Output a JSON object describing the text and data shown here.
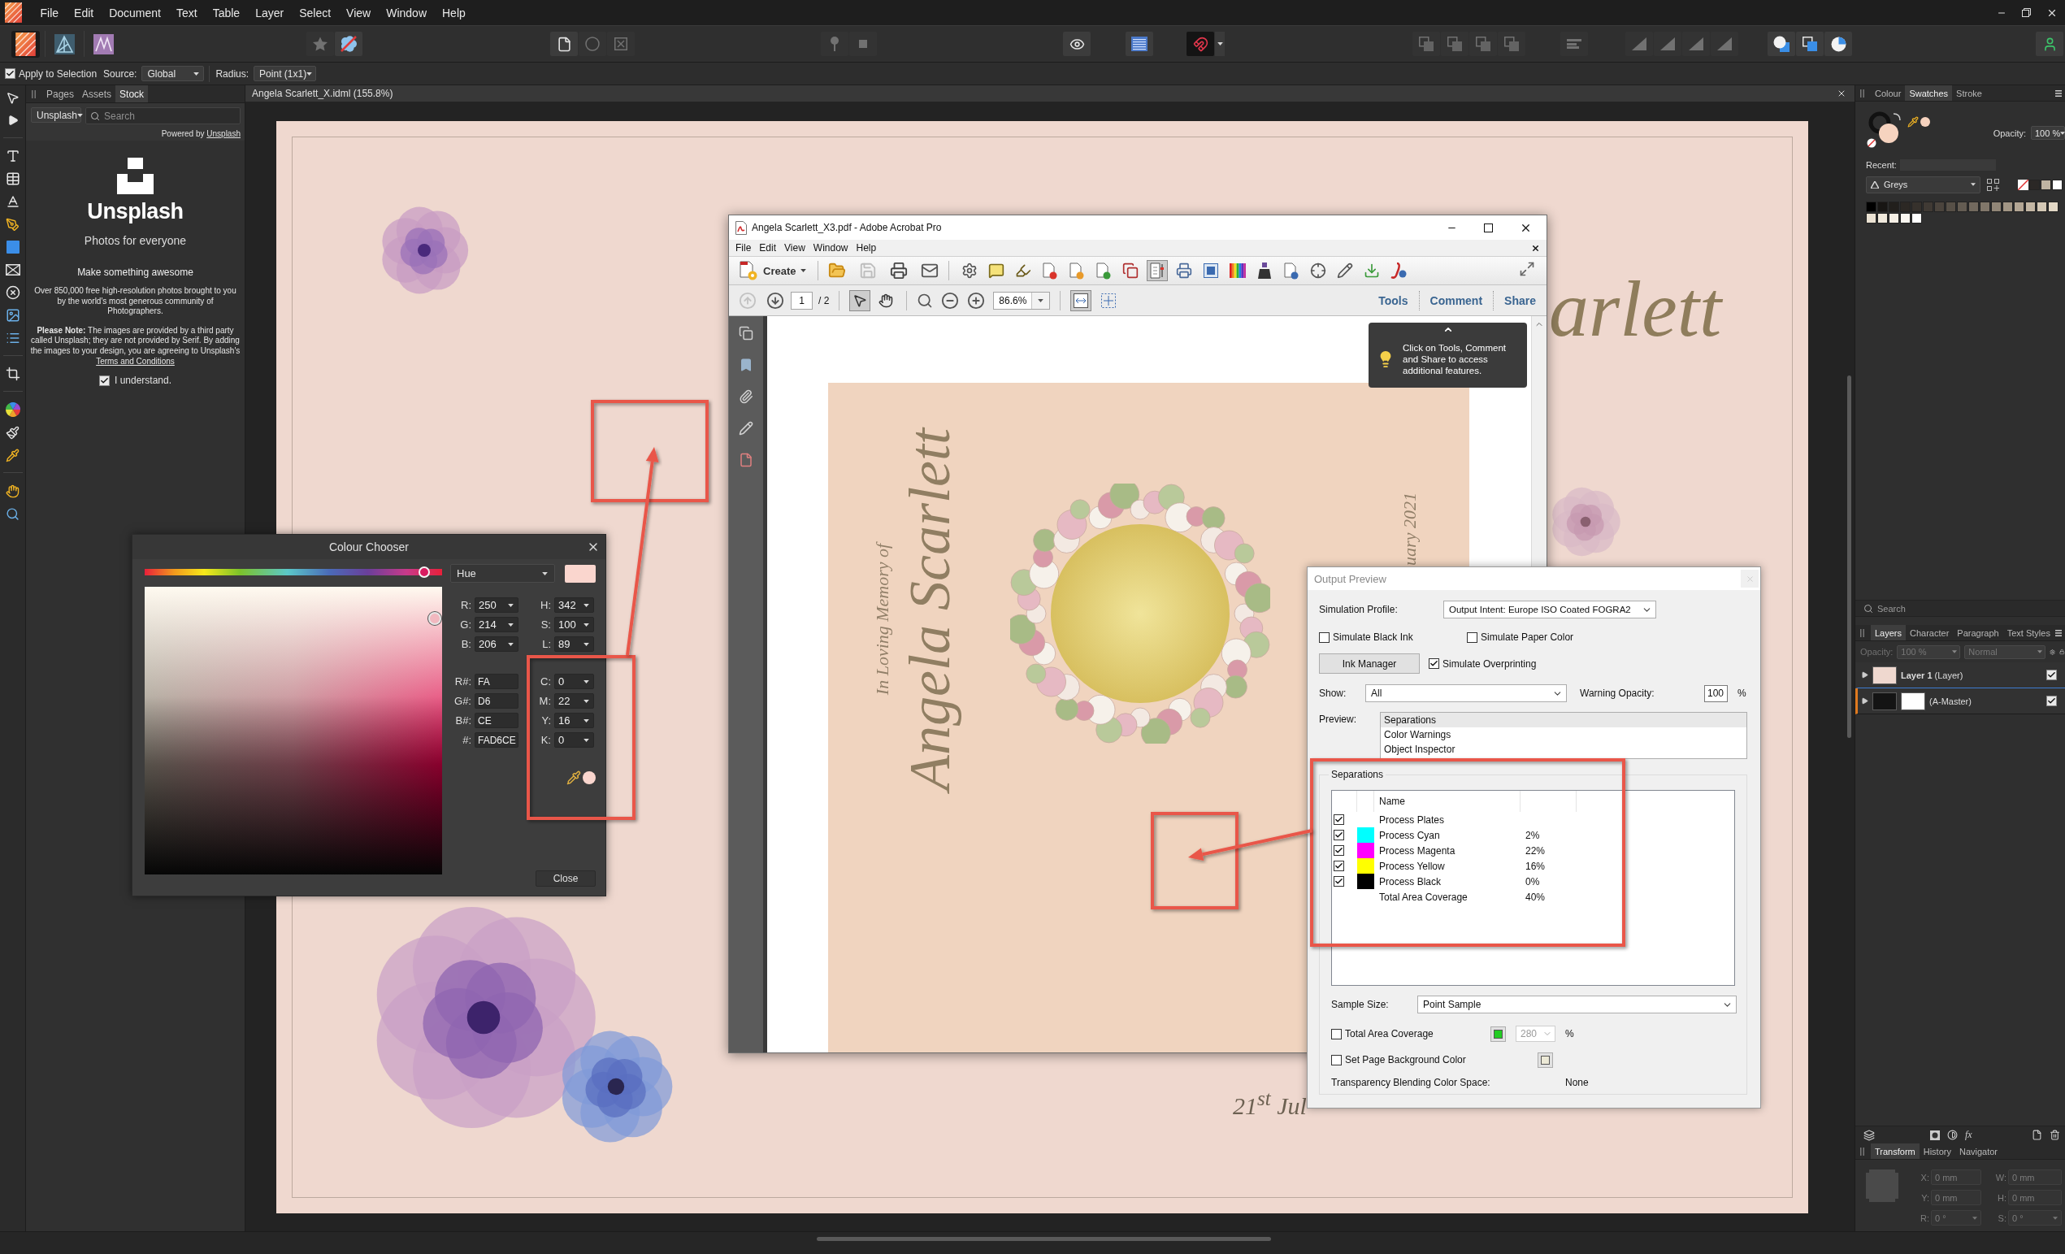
{
  "menu_bar": {
    "items": [
      "File",
      "Edit",
      "Document",
      "Text",
      "Table",
      "Layer",
      "Select",
      "View",
      "Window",
      "Help"
    ]
  },
  "toolbar": {
    "personas": [
      {
        "selected": true
      },
      {
        "selected": false
      },
      {
        "selected": false
      }
    ],
    "groups": [
      {
        "buttons": [
          {
            "disabled": true,
            "selected": false
          },
          {
            "disabled": false,
            "selected": false
          }
        ]
      },
      {
        "buttons": [
          {
            "disabled": false,
            "selected": false
          },
          {
            "disabled": true,
            "selected": false
          },
          {
            "disabled": true,
            "selected": false
          }
        ]
      },
      {
        "buttons": [
          {
            "disabled": true,
            "selected": false
          },
          {
            "disabled": true,
            "selected": false
          }
        ]
      },
      {
        "buttons": [
          {
            "disabled": false,
            "selected": false
          }
        ]
      },
      {
        "buttons": [
          {
            "disabled": false,
            "selected": false
          }
        ]
      },
      {
        "buttons": [
          {
            "disabled": false,
            "selected": true
          }
        ]
      },
      {
        "buttons": [
          {
            "disabled": true,
            "selected": false
          },
          {
            "disabled": true,
            "selected": false
          },
          {
            "disabled": true,
            "selected": false
          },
          {
            "disabled": true,
            "selected": false
          }
        ]
      },
      {
        "buttons": [
          {
            "disabled": true,
            "selected": false
          }
        ]
      },
      {
        "buttons": [
          {
            "disabled": true,
            "selected": false
          },
          {
            "disabled": true,
            "selected": false
          },
          {
            "disabled": true,
            "selected": false
          },
          {
            "disabled": true,
            "selected": false
          }
        ]
      },
      {
        "buttons": [
          {
            "disabled": false,
            "selected": false
          },
          {
            "disabled": false,
            "selected": false
          },
          {
            "disabled": false,
            "selected": false
          }
        ]
      },
      {
        "buttons": [
          {
            "disabled": false,
            "selected": false
          }
        ]
      }
    ]
  },
  "context_bar": {
    "apply_to_selection": {
      "label": "Apply to Selection",
      "checked": true
    },
    "source": {
      "label": "Source:",
      "value": "Global"
    },
    "radius": {
      "label": "Radius:",
      "value": "Point (1x1)"
    }
  },
  "stock_panel": {
    "tabs": [
      {
        "label": "Pages",
        "selected": false
      },
      {
        "label": "Assets",
        "selected": false
      },
      {
        "label": "Stock",
        "selected": true
      }
    ],
    "provider": "Unsplash",
    "search": {
      "placeholder": "Search"
    },
    "powered_by": "Powered by",
    "powered_link": "Unsplash",
    "brand": "Unsplash",
    "tagline": "Photos for everyone",
    "heading": "Make something awesome",
    "description": "Over 850,000 free high-resolution photos brought to you by the world's most generous community of Photographers.",
    "note": "**Please Note:** The images are provided by a third party called Unsplash; they are not provided by Serif. By adding the images to your design, you are agreeing to Unsplash's",
    "terms_link": "Terms and Conditions",
    "understand": {
      "label": "I understand.",
      "checked": true
    }
  },
  "document_tab": {
    "title": "Angela Scarlett_X.idml (155.8%)"
  },
  "page": {
    "title_fragment": "arlett",
    "date_fragment": "21$^{st}$ Jul"
  },
  "colour_chooser": {
    "title": "Colour Chooser",
    "mode": "Hue",
    "hue_slider": {
      "level": 0.94
    },
    "rgb": [
      {
        "label": "R:",
        "value": "250"
      },
      {
        "label": "G:",
        "value": "214"
      },
      {
        "label": "B:",
        "value": "206"
      }
    ],
    "hsl": [
      {
        "label": "H:",
        "value": "342"
      },
      {
        "label": "S:",
        "value": "100"
      },
      {
        "label": "L:",
        "value": "89"
      }
    ],
    "hex": [
      {
        "label": "R#:",
        "value": "FA"
      },
      {
        "label": "G#:",
        "value": "D6"
      },
      {
        "label": "B#:",
        "value": "CE"
      },
      {
        "label": "#:",
        "value": "FAD6CE"
      }
    ],
    "cmyk": [
      {
        "label": "C:",
        "value": "0"
      },
      {
        "label": "M:",
        "value": "22"
      },
      {
        "label": "Y:",
        "value": "16"
      },
      {
        "label": "K:",
        "value": "0"
      }
    ],
    "close": "Close"
  },
  "acrobat": {
    "title": "Angela Scarlett_X3.pdf - Adobe Acrobat Pro",
    "menu": [
      "File",
      "Edit",
      "View",
      "Window",
      "Help"
    ],
    "create": "Create",
    "file_tools": [
      {
        "disabled": false
      },
      {
        "disabled": true
      },
      {
        "disabled": false
      },
      {
        "disabled": false
      }
    ],
    "tools": [
      {
        "selected": false
      },
      {
        "selected": false
      },
      {
        "selected": false
      },
      {
        "selected": false
      },
      {
        "selected": false
      },
      {
        "selected": false
      },
      {
        "selected": false
      },
      {
        "selected": true
      },
      {
        "selected": false
      },
      {
        "selected": false
      },
      {
        "selected": false
      },
      {
        "selected": false
      },
      {
        "selected": false
      },
      {
        "selected": false
      },
      {
        "selected": false
      },
      {
        "selected": false
      },
      {
        "selected": false
      }
    ],
    "page_buttons": [
      {
        "disabled": true
      },
      {
        "disabled": false
      }
    ],
    "page_number": "1",
    "page_count": "/ 2",
    "nav_tools": [
      {
        "selected": true
      },
      {
        "selected": false
      }
    ],
    "zoom": "86.6%",
    "fit_tools": [
      {
        "selected": true
      },
      {
        "selected": false
      }
    ],
    "panes": [
      "Tools",
      "Comment",
      "Share"
    ],
    "tooltip": "Click on Tools, Comment and Share to access additional features.",
    "document": {
      "dedication": "In Loving Memory of",
      "name": "Angela Scarlett",
      "date_fragment": "uary 2021"
    }
  },
  "output_preview": {
    "title": "Output Preview",
    "simulation_profile": {
      "label": "Simulation Profile:",
      "value": "Output Intent: Europe ISO Coated FOGRA2"
    },
    "options": [
      {
        "label": "Simulate Black Ink",
        "checked": false
      },
      {
        "label": "Simulate Paper Color",
        "checked": false
      }
    ],
    "ink_manager": "Ink Manager",
    "overprinting": {
      "label": "Simulate Overprinting",
      "checked": true
    },
    "show": {
      "label": "Show:",
      "value": "All"
    },
    "warning_opacity": {
      "label": "Warning Opacity:",
      "value": "100",
      "unit": "%"
    },
    "preview": {
      "label": "Preview:",
      "items": [
        {
          "label": "Separations",
          "selected": true
        },
        {
          "label": "Color Warnings",
          "selected": false
        },
        {
          "label": "Object Inspector",
          "selected": false
        }
      ]
    },
    "separations": {
      "title": "Separations",
      "column": "Name",
      "rows": [
        {
          "kind": "plate",
          "checked": true,
          "name": "Process Plates"
        },
        {
          "kind": "ink",
          "checked": true,
          "color": "#00ffff",
          "name": "Process Cyan",
          "value": "2%"
        },
        {
          "kind": "ink",
          "checked": true,
          "color": "#ff00ff",
          "name": "Process Magenta",
          "value": "22%"
        },
        {
          "kind": "ink",
          "checked": true,
          "color": "#ffff00",
          "name": "Process Yellow",
          "value": "16%"
        },
        {
          "kind": "ink",
          "checked": true,
          "color": "#000000",
          "name": "Process Black",
          "value": "0%"
        },
        {
          "kind": "total",
          "name": "Total Area Coverage",
          "value": "40%"
        }
      ]
    },
    "sample_size": {
      "label": "Sample Size:",
      "value": "Point Sample"
    },
    "total_area_coverage": {
      "label": "Total Area Coverage",
      "checked": false,
      "value": "280",
      "unit": "%",
      "disabled": true
    },
    "page_background": {
      "label": "Set Page Background Color",
      "checked": false
    },
    "blending": {
      "label": "Transparency Blending Color Space:",
      "value": "None"
    }
  },
  "swatches_panel": {
    "tabs": [
      {
        "label": "Colour",
        "selected": false
      },
      {
        "label": "Swatches",
        "selected": true
      },
      {
        "label": "Stroke",
        "selected": false
      }
    ],
    "opacity": {
      "label": "Opacity:",
      "value": "100 %"
    },
    "recent_label": "Recent:",
    "palette": "Greys",
    "recent": [
      {
        "kind": "none"
      },
      {
        "kind": "color",
        "color": "#2b2826"
      },
      {
        "kind": "color",
        "color": "#bfb4a2"
      },
      {
        "kind": "color",
        "color": "#ffffff"
      }
    ],
    "swatches": [
      {
        "color": "#000000"
      },
      {
        "color": "#181614"
      },
      {
        "color": "#221f1c"
      },
      {
        "color": "#2c2824"
      },
      {
        "color": "#36312c"
      },
      {
        "color": "#403a34"
      },
      {
        "color": "#4b443d"
      },
      {
        "color": "#575047"
      },
      {
        "color": "#645c52"
      },
      {
        "color": "#72695e"
      },
      {
        "color": "#81776a"
      },
      {
        "color": "#918677"
      },
      {
        "color": "#a29685"
      },
      {
        "color": "#b3a694"
      },
      {
        "color": "#c4b7a4"
      },
      {
        "color": "#d4c8b5"
      },
      {
        "color": "#e3d8c6"
      },
      {
        "color": "#ebe2d3"
      },
      {
        "color": "#f0e9dc"
      },
      {
        "color": "#f5efe5"
      },
      {
        "color": "#faf6f0"
      },
      {
        "color": "#ffffff"
      }
    ]
  },
  "search": {
    "placeholder": "Search"
  },
  "layers_panel": {
    "tabs": [
      {
        "label": "Layers",
        "selected": true
      },
      {
        "label": "Character",
        "selected": false
      },
      {
        "label": "Paragraph",
        "selected": false
      },
      {
        "label": "Text Styles",
        "selected": false
      }
    ],
    "opacity": {
      "label": "Opacity:",
      "value": "100 %",
      "disabled": true
    },
    "blend_mode": {
      "value": "Normal",
      "disabled": true
    },
    "layers": [
      {
        "kind": "layer",
        "name": "Layer 1",
        "suffix": "(Layer)",
        "checked": true
      },
      {
        "kind": "master",
        "name": "(A-Master)",
        "checked": true
      }
    ],
    "fx_button": "fx"
  },
  "transform_panel": {
    "tabs": [
      {
        "label": "Transform",
        "selected": true
      },
      {
        "label": "History",
        "selected": false
      },
      {
        "label": "Navigator",
        "selected": false
      }
    ],
    "disabled": true,
    "fields": [
      {
        "kind": "length",
        "label": "X:",
        "value": "0 mm"
      },
      {
        "kind": "length",
        "label": "W:",
        "value": "0 mm"
      },
      {
        "kind": "length",
        "label": "Y:",
        "value": "0 mm"
      },
      {
        "kind": "length",
        "label": "H:",
        "value": "0 mm"
      },
      {
        "kind": "angle",
        "label": "R:",
        "value": "0 °"
      },
      {
        "kind": "angle",
        "label": "S:",
        "value": "0 °"
      }
    ]
  }
}
